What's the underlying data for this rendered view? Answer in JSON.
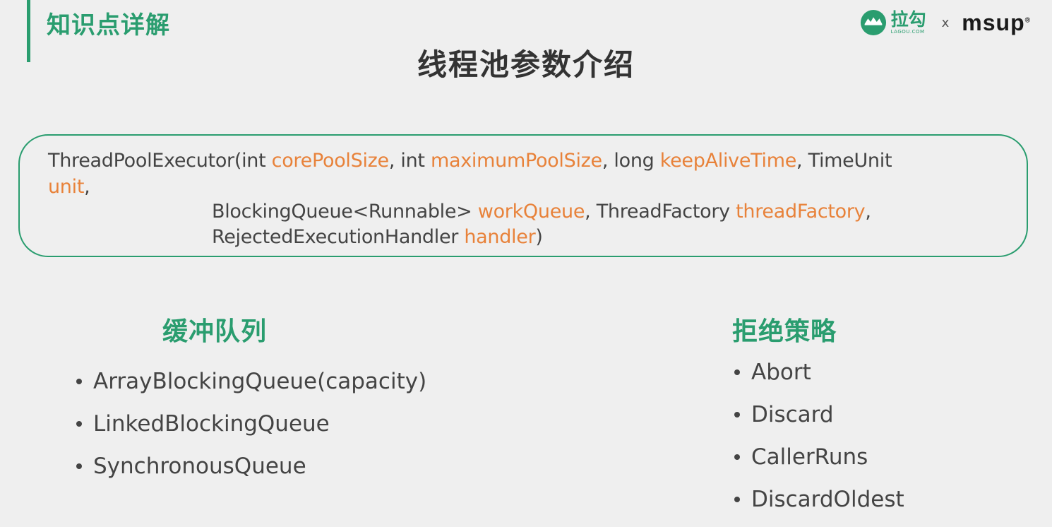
{
  "header": {
    "section_label": "知识点详解",
    "brand": {
      "lagou_name": "拉勾",
      "lagou_url": "LAGOU.COM",
      "separator": "x",
      "msup": "msup",
      "registered": "®"
    }
  },
  "title": "线程池参数介绍",
  "signature": {
    "line1": [
      {
        "text": "ThreadPoolExecutor(int ",
        "highlight": false
      },
      {
        "text": "corePoolSize",
        "highlight": true
      },
      {
        "text": ", int ",
        "highlight": false
      },
      {
        "text": "maximumPoolSize",
        "highlight": true
      },
      {
        "text": ", long ",
        "highlight": false
      },
      {
        "text": "keepAliveTime",
        "highlight": true
      },
      {
        "text": ", TimeUnit",
        "highlight": false
      }
    ],
    "line2": [
      {
        "text": "unit",
        "highlight": true
      },
      {
        "text": ",",
        "highlight": false
      }
    ],
    "line3": [
      {
        "text": "BlockingQueue<Runnable> ",
        "highlight": false
      },
      {
        "text": "workQueue",
        "highlight": true
      },
      {
        "text": ", ThreadFactory ",
        "highlight": false
      },
      {
        "text": "threadFactory",
        "highlight": true
      },
      {
        "text": ",",
        "highlight": false
      }
    ],
    "line4": [
      {
        "text": "RejectedExecutionHandler ",
        "highlight": false
      },
      {
        "text": "handler",
        "highlight": true
      },
      {
        "text": ")",
        "highlight": false
      }
    ]
  },
  "buffer_queues": {
    "heading": "缓冲队列",
    "items": [
      "ArrayBlockingQueue(capacity)",
      "LinkedBlockingQueue",
      "SynchronousQueue"
    ]
  },
  "rejection_policies": {
    "heading": "拒绝策略",
    "items": [
      "Abort",
      "Discard",
      "CallerRuns",
      "DiscardOldest"
    ]
  },
  "colors": {
    "accent": "#2a9d6f",
    "highlight": "#e8823a",
    "text": "#444444",
    "background": "#efefef"
  }
}
